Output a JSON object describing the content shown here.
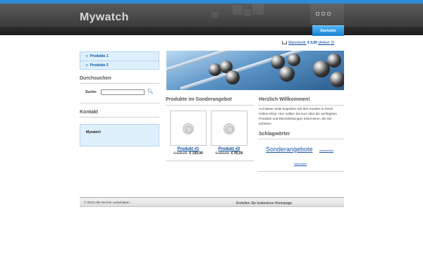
{
  "header": {
    "site_title": "Mywatch"
  },
  "nav": {
    "active_label": "Startseite"
  },
  "sidebar": {
    "menu": [
      {
        "arrow": "»",
        "label": "Produkte 1"
      },
      {
        "arrow": "»",
        "label": "Produkte 2"
      }
    ],
    "search_heading": "Durchsuchen",
    "search_label": "Suche:",
    "search_value": "",
    "search_button_icon": "magnifier-icon",
    "contact_heading": "Kontakt",
    "contact_name": "Mywatch"
  },
  "cart": {
    "label": "Warenkorb:",
    "total": "€ 0,00",
    "items": "(Artikel: 0)"
  },
  "products": {
    "heading": "Produkte im Sonderangebot",
    "items": [
      {
        "name": "Produkt #1",
        "old_price": "€ 125,00",
        "new_price": "€ 100,00"
      },
      {
        "name": "Produkt #2",
        "old_price": "€ 100,00",
        "new_price": "€ 95,00"
      }
    ]
  },
  "welcome": {
    "heading": "Herzlich Willkommen!",
    "text": "Auf dieser Seite begrüßen Sie Ihre Kunden in Ihrem Online-Shop. Hier sollten Sie kurz über die wichtigsten Produkte und Dienstleistungen informieren, die Sie anbieten"
  },
  "tags": {
    "heading": "Schlagwörter",
    "items": [
      "Sonderangebote",
      "Ausverkauf",
      "Neuheiten"
    ]
  },
  "footer": {
    "copyright": "© 2016 Alle Rechte vorbehalten.",
    "link": "Erstellen Sie kostenlose Homepage"
  }
}
